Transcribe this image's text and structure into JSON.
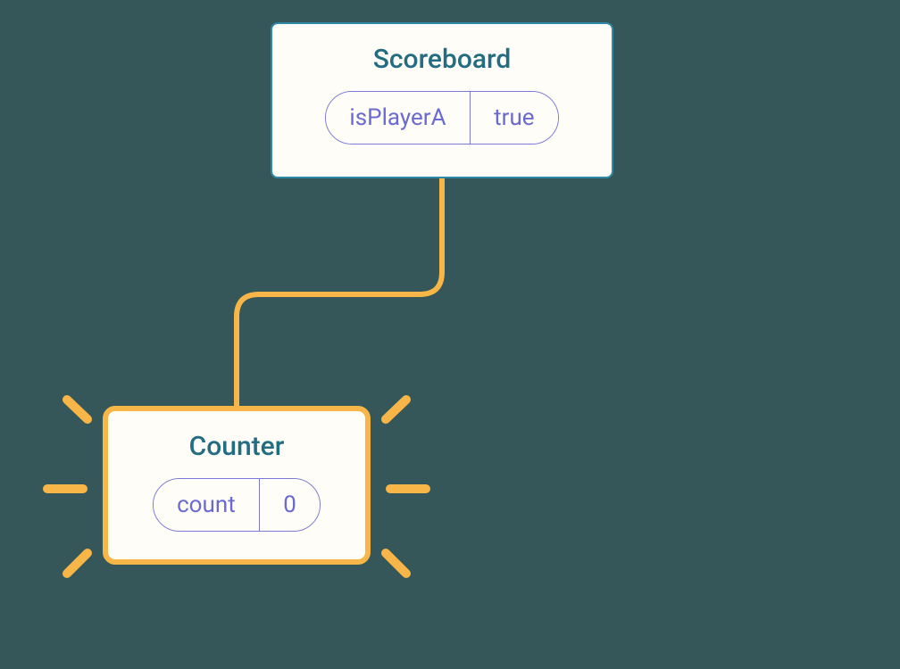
{
  "colors": {
    "background": "#35575A",
    "nodeFill": "#FEFDF7",
    "titleText": "#236C82",
    "pillBorder": "#7A79D6",
    "pillText": "#6B6AD1",
    "topBorder": "#2F89A9",
    "highlightBorder": "#F8B648",
    "connector": "#F8B648"
  },
  "nodes": {
    "top": {
      "title": "Scoreboard",
      "prop_key": "isPlayerA",
      "prop_value": "true"
    },
    "bottom": {
      "title": "Counter",
      "prop_key": "count",
      "prop_value": "0",
      "highlighted": true
    }
  },
  "edges": [
    {
      "from": "top",
      "to": "bottom"
    }
  ]
}
